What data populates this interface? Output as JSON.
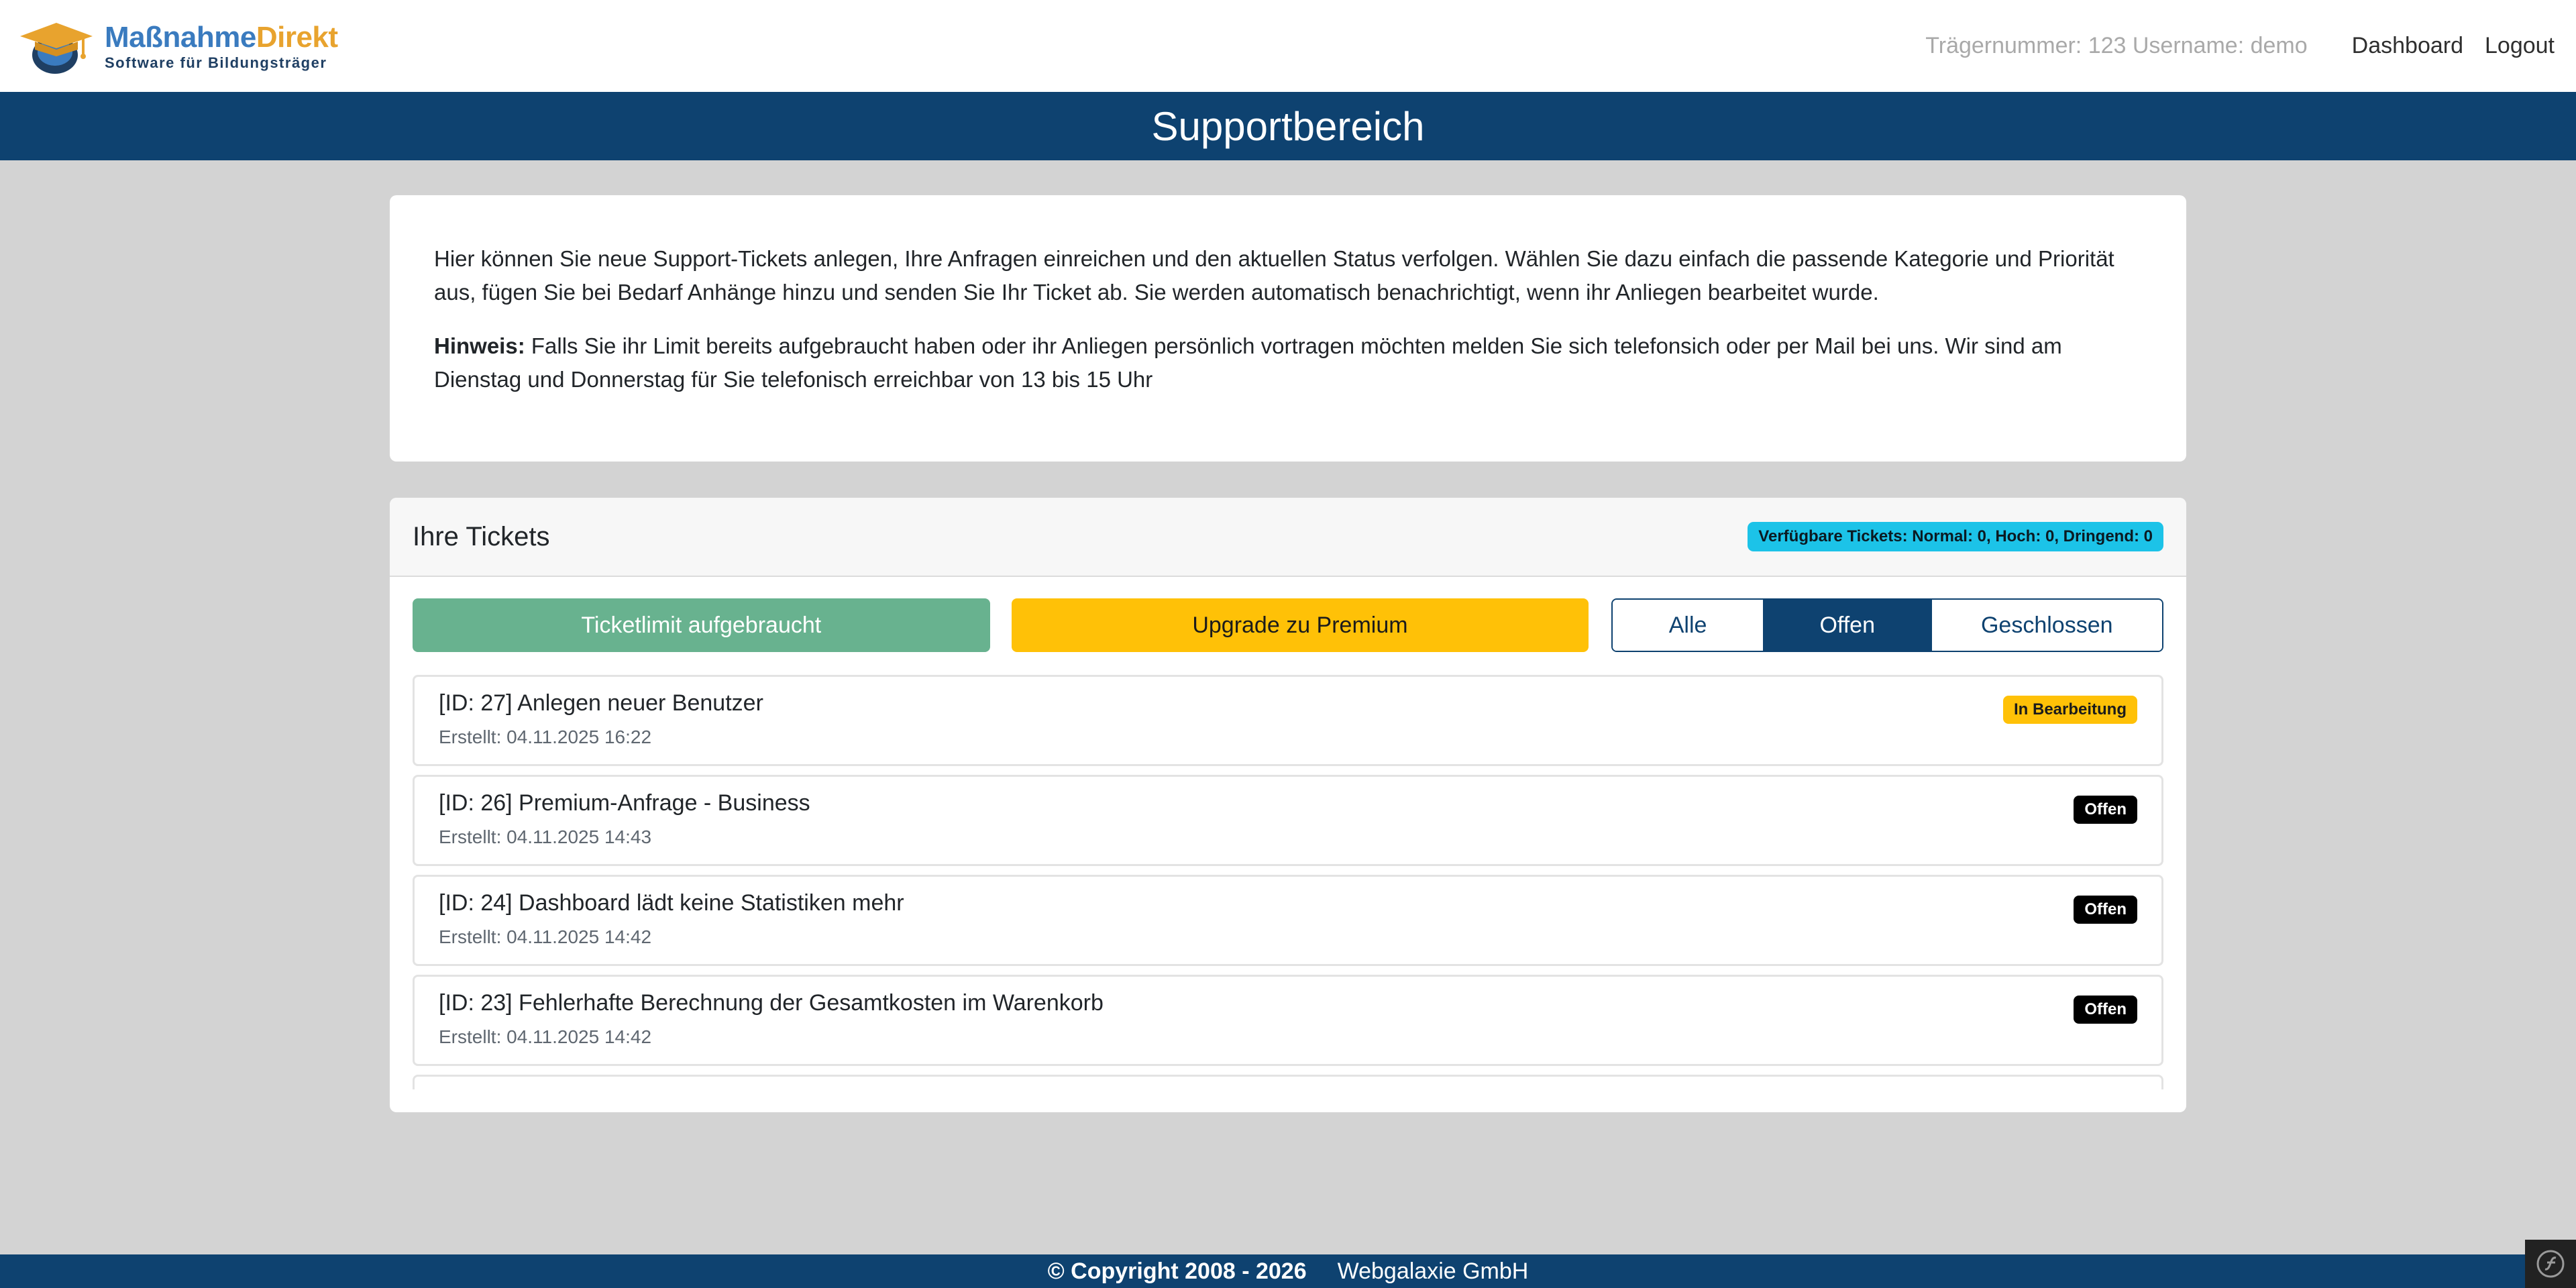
{
  "brand": {
    "name_part1": "Maßnahme",
    "name_part2": "Direkt",
    "tagline": "Software für Bildungsträger"
  },
  "nav": {
    "user_info": "Trägernummer: 123 Username: demo",
    "dashboard": "Dashboard",
    "logout": "Logout"
  },
  "header": {
    "title": "Supportbereich"
  },
  "info": {
    "paragraph1": "Hier können Sie neue Support-Tickets anlegen, Ihre Anfragen einreichen und den aktuellen Status verfolgen. Wählen Sie dazu einfach die passende Kategorie und Priorität aus, fügen Sie bei Bedarf Anhänge hinzu und senden Sie Ihr Ticket ab. Sie werden automatisch benachrichtigt, wenn ihr Anliegen bearbeitet wurde.",
    "hint_label": "Hinweis:",
    "hint_text": " Falls Sie ihr Limit bereits aufgebraucht haben oder ihr Anliegen persönlich vortragen möchten melden Sie sich telefonsich oder per Mail bei uns. Wir sind am Dienstag und Donnerstag für Sie telefonisch erreichbar von 13 bis 15 Uhr"
  },
  "tickets": {
    "title": "Ihre Tickets",
    "available_badge": "Verfügbare Tickets: Normal: 0, Hoch: 0, Dringend: 0",
    "limit_button": "Ticketlimit aufgebraucht",
    "premium_button": "Upgrade zu Premium",
    "filters": {
      "all": "Alle",
      "open": "Offen",
      "closed": "Geschlossen",
      "active": "open"
    },
    "items": [
      {
        "title": "[ID: 27] Anlegen neuer Benutzer",
        "created": "Erstellt: 04.11.2025 16:22",
        "status": "In Bearbeitung"
      },
      {
        "title": "[ID: 26] Premium-Anfrage - Business",
        "created": "Erstellt: 04.11.2025 14:43",
        "status": "Offen"
      },
      {
        "title": "[ID: 24] Dashboard lädt keine Statistiken mehr",
        "created": "Erstellt: 04.11.2025 14:42",
        "status": "Offen"
      },
      {
        "title": "[ID: 23] Fehlerhafte Berechnung der Gesamtkosten im Warenkorb",
        "created": "Erstellt: 04.11.2025 14:42",
        "status": "Offen"
      }
    ]
  },
  "footer": {
    "copyright": "© Copyright 2008 - 2026",
    "company": "Webgalaxie GmbH"
  },
  "colors": {
    "primary": "#0e4270",
    "success": "#68b28f",
    "warning": "#ffc107",
    "info": "#1cc3e8",
    "background": "#d3d3d3"
  }
}
